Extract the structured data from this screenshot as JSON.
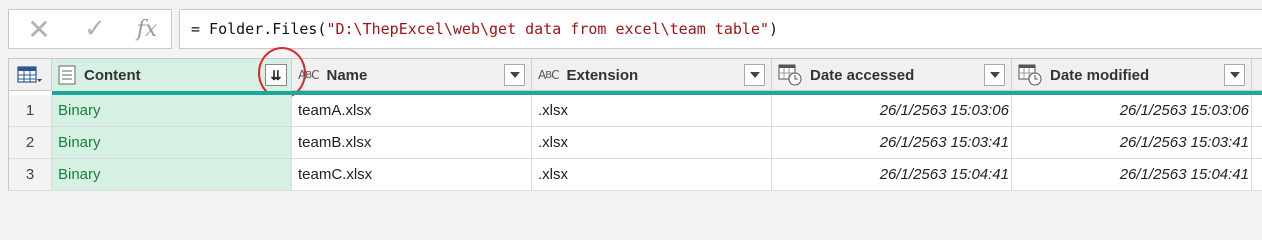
{
  "formula_bar": {
    "cancel_icon": "close-icon",
    "cancel_glyph": "✕",
    "confirm_icon": "check-icon",
    "confirm_glyph": "✓",
    "fx_label": "fx",
    "formula_prefix": "= Folder.Files(",
    "formula_string": "\"D:\\ThepExcel\\web\\get data from excel\\team table\"",
    "formula_suffix": ")"
  },
  "table": {
    "columns": [
      {
        "key": "content",
        "label": "Content",
        "type_icon": "list-icon"
      },
      {
        "key": "name",
        "label": "Name",
        "type_icon": "text-type-icon",
        "type_glyph_a": "A",
        "type_glyph_b": "B",
        "type_glyph_c": "C"
      },
      {
        "key": "extension",
        "label": "Extension",
        "type_icon": "text-type-icon",
        "type_glyph_a": "A",
        "type_glyph_b": "B",
        "type_glyph_c": "C"
      },
      {
        "key": "date_accessed",
        "label": "Date accessed",
        "type_icon": "datetime-type-icon"
      },
      {
        "key": "date_modified",
        "label": "Date modified",
        "type_icon": "datetime-type-icon"
      }
    ],
    "expand_glyph": "⇊",
    "accent_color": "#1aa89a",
    "rows": [
      {
        "num": "1",
        "content": "Binary",
        "name": "teamA.xlsx",
        "extension": ".xlsx",
        "date_accessed": "26/1/2563 15:03:06",
        "date_modified": "26/1/2563 15:03:06"
      },
      {
        "num": "2",
        "content": "Binary",
        "name": "teamB.xlsx",
        "extension": ".xlsx",
        "date_accessed": "26/1/2563 15:03:41",
        "date_modified": "26/1/2563 15:03:41"
      },
      {
        "num": "3",
        "content": "Binary",
        "name": "teamC.xlsx",
        "extension": ".xlsx",
        "date_accessed": "26/1/2563 15:04:41",
        "date_modified": "26/1/2563 15:04:41"
      }
    ]
  }
}
